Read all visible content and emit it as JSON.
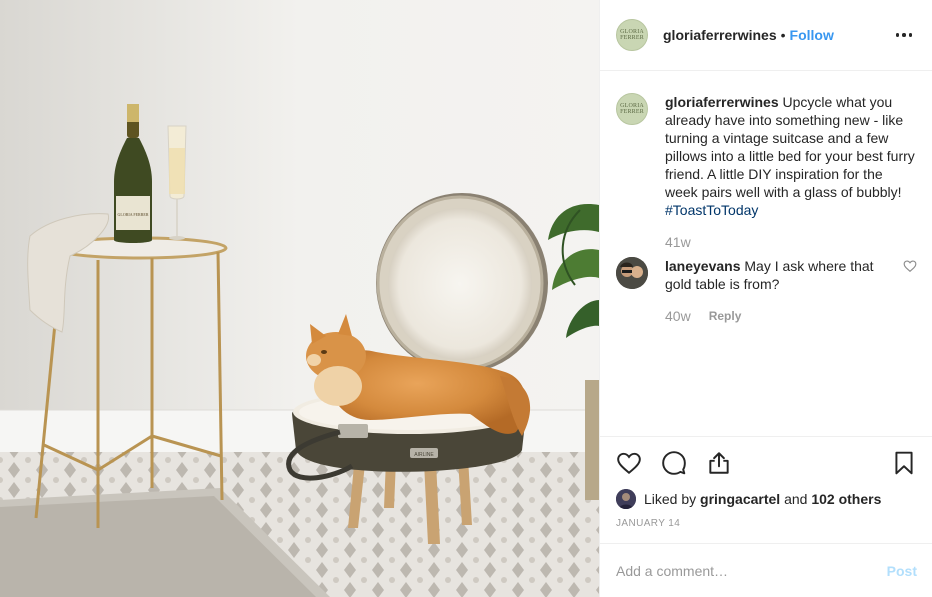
{
  "post": {
    "username": "gloriaferrerwines",
    "avatar_text": "GLORIA FERRER",
    "separator": "•",
    "follow_label": "Follow",
    "more_icon": "ellipsis-icon"
  },
  "caption": {
    "username": "gloriaferrerwines",
    "text": "Upcycle what you already have into something new - like turning a vintage suitcase and a few pillows into a little bed for your best furry friend. A little DIY inspiration for the week pairs well with a glass of bubbly!",
    "hashtag": "#ToastToToday",
    "time": "41w"
  },
  "comments": [
    {
      "username": "laneyevans",
      "text": "May I ask where that gold table is from?",
      "time": "40w",
      "reply_label": "Reply"
    }
  ],
  "actions": {
    "like_icon": "heart-icon",
    "comment_icon": "comment-icon",
    "share_icon": "share-icon",
    "save_icon": "bookmark-icon"
  },
  "likes": {
    "prefix": "Liked by",
    "user": "gringacartel",
    "and": "and",
    "others": "102 others"
  },
  "date": "JANUARY 14",
  "add_comment": {
    "placeholder": "Add a comment…",
    "post_label": "Post"
  },
  "photo": {
    "bottle_label": "GLORIA FERRER",
    "suitcase_tag": "AIRLINE"
  },
  "colors": {
    "link": "#3897f0",
    "hashtag": "#003569",
    "muted": "#999999",
    "post_disabled": "#b2dffc"
  }
}
